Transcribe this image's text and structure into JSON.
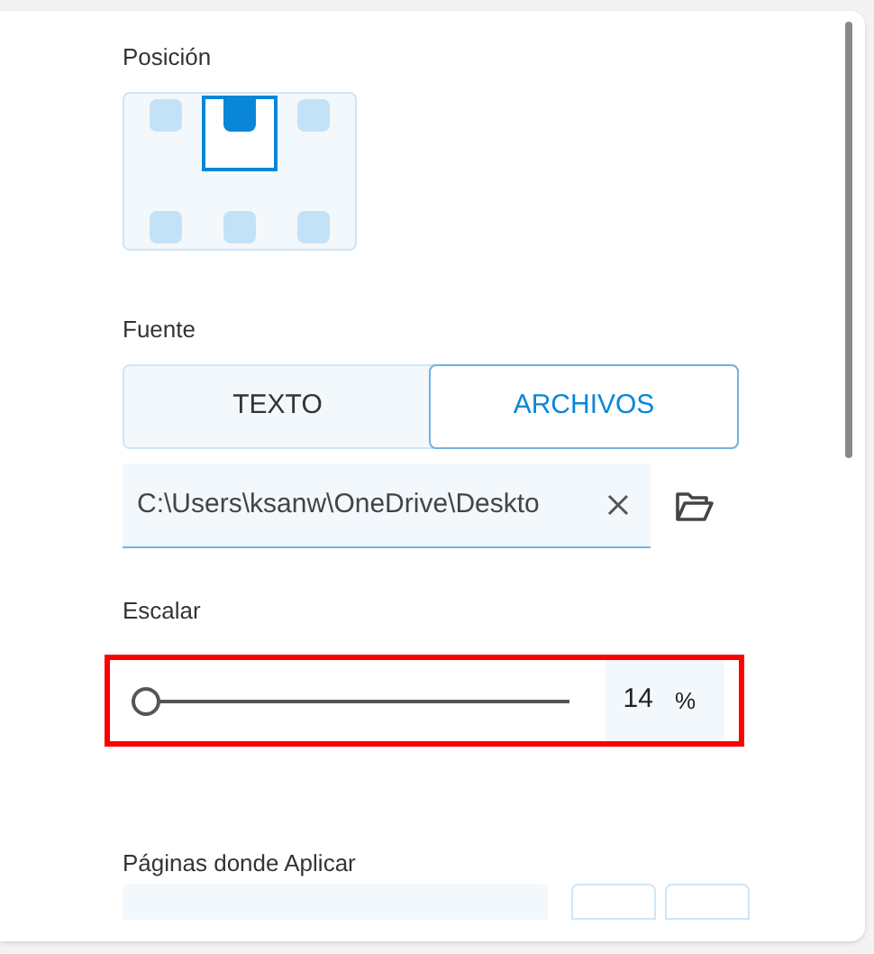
{
  "position": {
    "label": "Posición",
    "cells": [
      {
        "selected": false
      },
      {
        "selected": true
      },
      {
        "selected": false
      },
      {
        "selected": false
      },
      {
        "selected": false
      },
      {
        "selected": false
      }
    ]
  },
  "source": {
    "label": "Fuente",
    "tabs": [
      {
        "label": "TEXTO",
        "selected": false
      },
      {
        "label": "ARCHIVOS",
        "selected": true
      }
    ],
    "path": {
      "value": "C:\\Users\\ksanw\\OneDrive\\Deskto"
    }
  },
  "scale": {
    "label": "Escalar",
    "level": 0.0,
    "value": "14",
    "unit": "%",
    "highlighted": true
  },
  "pages": {
    "label": "Páginas donde Aplicar"
  }
}
